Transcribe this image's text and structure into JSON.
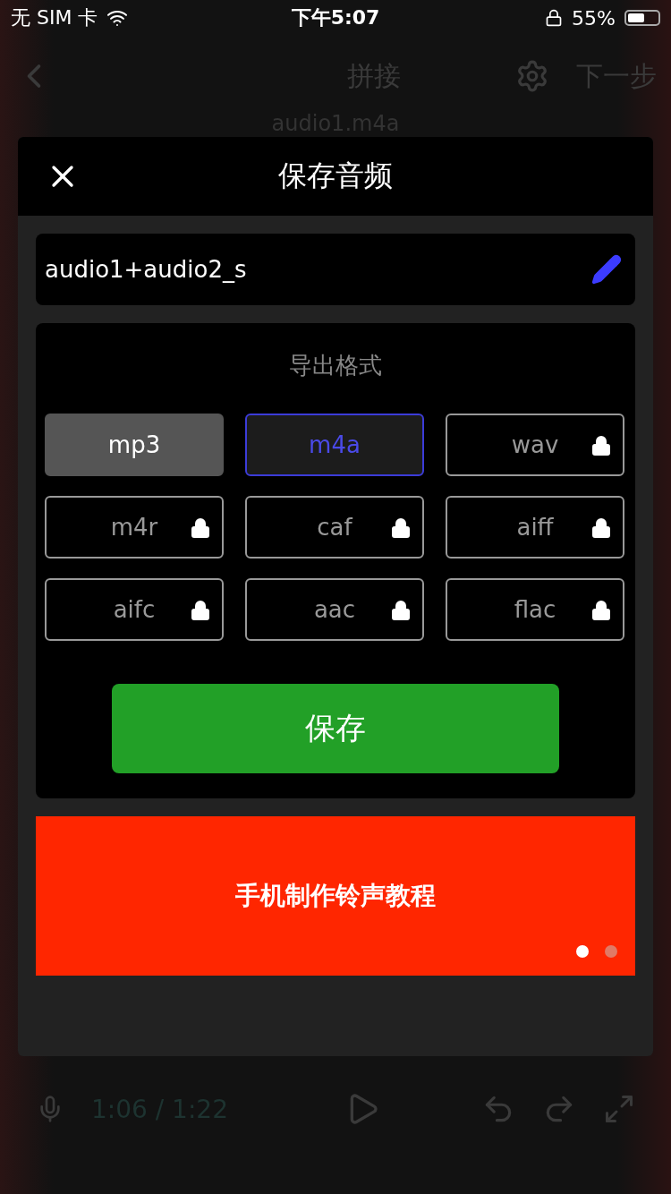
{
  "status_bar": {
    "carrier": "无 SIM 卡",
    "time": "下午5:07",
    "battery": "55%"
  },
  "background_app": {
    "title": "拼接",
    "next": "下一步",
    "track_name": "audio1.m4a",
    "time": "1:06 / 1:22"
  },
  "dialog": {
    "title": "保存音频",
    "file_name": "audio1+audio2_s",
    "format_heading": "导出格式",
    "formats": [
      {
        "label": "mp3",
        "locked": false,
        "selected": false
      },
      {
        "label": "m4a",
        "locked": false,
        "selected": true
      },
      {
        "label": "wav",
        "locked": true,
        "selected": false
      },
      {
        "label": "m4r",
        "locked": true,
        "selected": false
      },
      {
        "label": "caf",
        "locked": true,
        "selected": false
      },
      {
        "label": "aiff",
        "locked": true,
        "selected": false
      },
      {
        "label": "aifc",
        "locked": true,
        "selected": false
      },
      {
        "label": "aac",
        "locked": true,
        "selected": false
      },
      {
        "label": "flac",
        "locked": true,
        "selected": false
      }
    ],
    "save_button": "保存",
    "banner": {
      "text": "手机制作铃声教程",
      "dots": [
        {
          "selected": true
        },
        {
          "selected": false
        }
      ]
    }
  }
}
